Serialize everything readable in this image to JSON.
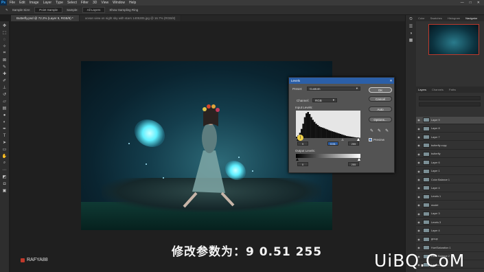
{
  "menu": {
    "logo": "Ps",
    "items": [
      "File",
      "Edit",
      "Image",
      "Layer",
      "Type",
      "Select",
      "Filter",
      "3D",
      "View",
      "Window",
      "Help"
    ],
    "window_controls": [
      "—",
      "□",
      "✕"
    ]
  },
  "options": {
    "sample_label": "Sample Size:",
    "sample_value": "Point Sample",
    "sample2_label": "Sample:",
    "sample2_value": "All Layers",
    "ring_label": "Show Sampling Ring"
  },
  "tabs": [
    {
      "label": "Butterfly.psd @ 72.2% (Layer 9, RGB/8) *"
    },
    {
      "label": "ocean view on night sky with stars 1405305.jpg @ 16.7% (RGB/8)"
    }
  ],
  "dialog": {
    "title": "Levels",
    "close": "✕",
    "preset_label": "Preset:",
    "preset_value": "Custom",
    "channel_label": "Channel:",
    "channel_value": "RGB",
    "input_label": "Input Levels:",
    "input_black": "9",
    "input_mid": "0.51",
    "input_white": "255",
    "output_label": "Output Levels:",
    "output_black": "0",
    "output_white": "255",
    "ok": "OK",
    "cancel": "Cancel",
    "auto": "Auto",
    "options": "Options...",
    "preview": "Preview",
    "preview_checked": true,
    "histogram_levels": [
      0.05,
      0.1,
      0.2,
      0.35,
      0.55,
      0.8,
      0.95,
      1,
      0.92,
      0.8,
      0.7,
      0.62,
      0.55,
      0.5,
      0.45,
      0.42,
      0.4,
      0.38,
      0.35,
      0.33,
      0.3,
      0.28,
      0.26,
      0.24,
      0.22,
      0.2,
      0.18,
      0.16,
      0.14,
      0.12,
      0.1,
      0.08,
      0.07,
      0.06,
      0.05,
      0.04,
      0.03,
      0.02,
      0.02,
      0.01
    ]
  },
  "subtitle": "修改参数为：9 0.51 255",
  "watermark_left": "RAFYA88",
  "watermark_right": "UiBQ.CoM",
  "panels": {
    "nav_tabs": [
      "Color",
      "Swatches",
      "Histogram",
      "Navigator"
    ],
    "layer_tabs": [
      "Layers",
      "Channels",
      "Paths"
    ],
    "layers": [
      {
        "name": "Layer 9",
        "active": true
      },
      {
        "name": "Layer 8",
        "active": false
      },
      {
        "name": "Layer 7",
        "active": false
      },
      {
        "name": "butterfly copy",
        "active": false
      },
      {
        "name": "butterfly",
        "active": false
      },
      {
        "name": "Layer 6",
        "active": false
      },
      {
        "name": "Layer 1",
        "active": false
      },
      {
        "name": "Color Balance 1",
        "active": false
      },
      {
        "name": "Layer 4",
        "active": false
      },
      {
        "name": "Levels 1",
        "active": false
      },
      {
        "name": "model",
        "active": false
      },
      {
        "name": "Layer 3",
        "active": false
      },
      {
        "name": "Levels 3",
        "active": false
      },
      {
        "name": "Layer 4",
        "active": false
      },
      {
        "name": "group",
        "active": false
      },
      {
        "name": "Hue/Saturation 1",
        "active": false
      },
      {
        "name": "Color Balance 2",
        "active": false
      },
      {
        "name": "Levels 2",
        "active": false
      }
    ]
  },
  "colors": {
    "accent": "#2b5fa8",
    "highlight": "#c0392b"
  }
}
